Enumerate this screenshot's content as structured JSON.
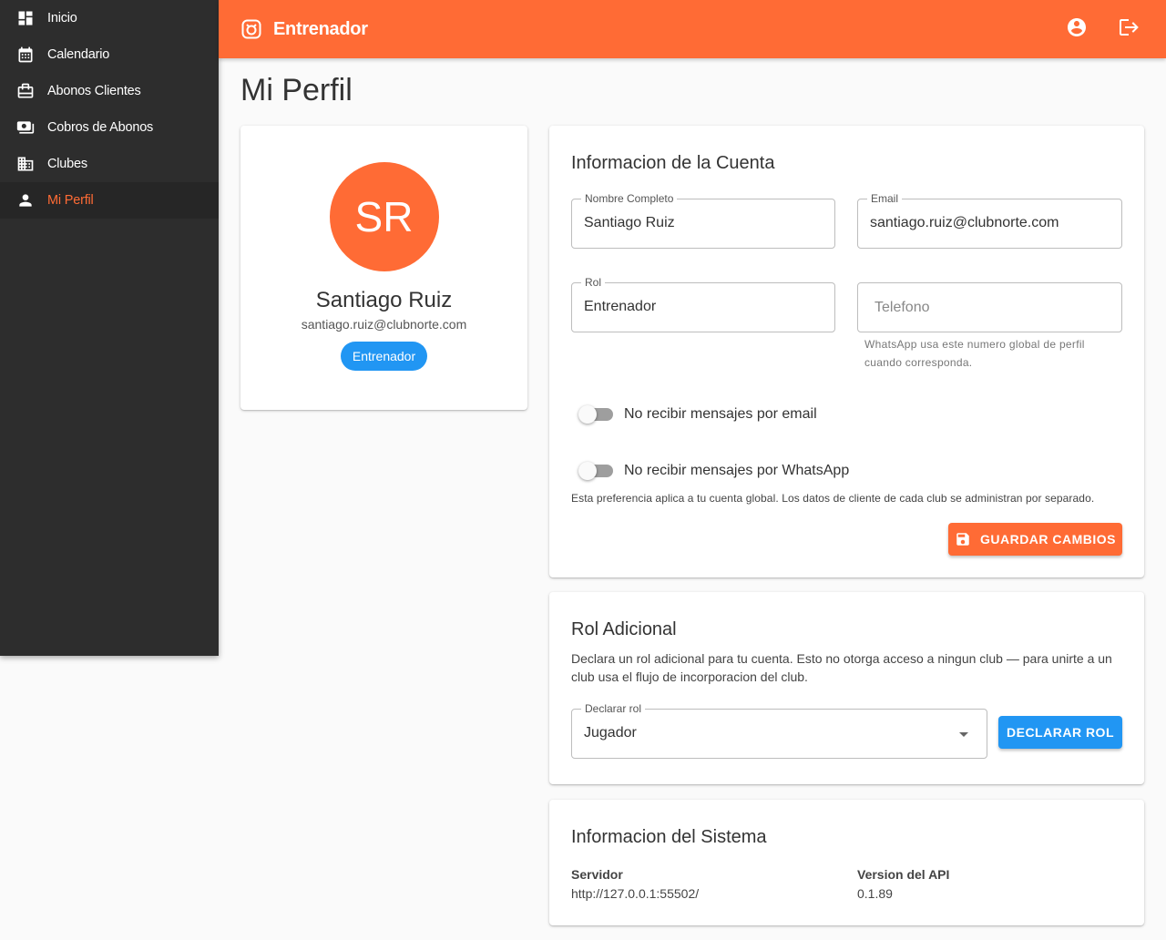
{
  "sidebar": {
    "items": [
      {
        "label": "Inicio",
        "icon": "dashboard-icon"
      },
      {
        "label": "Calendario",
        "icon": "calendar-icon"
      },
      {
        "label": "Abonos Clientes",
        "icon": "card-membership-icon"
      },
      {
        "label": "Cobros de Abonos",
        "icon": "payments-icon"
      },
      {
        "label": "Clubes",
        "icon": "building-icon"
      },
      {
        "label": "Mi Perfil",
        "icon": "person-icon",
        "active": true
      }
    ]
  },
  "header": {
    "title": "Entrenador",
    "brand_icon": "tennis-court-icon",
    "actions": [
      "account-circle-icon",
      "logout-icon"
    ]
  },
  "page": {
    "title": "Mi Perfil"
  },
  "profile": {
    "initials": "SR",
    "name": "Santiago Ruiz",
    "email": "santiago.ruiz@clubnorte.com",
    "role": "Entrenador"
  },
  "account": {
    "title": "Informacion de la Cuenta",
    "fields": {
      "full_name": {
        "label": "Nombre Completo",
        "value": "Santiago Ruiz"
      },
      "email": {
        "label": "Email",
        "value": "santiago.ruiz@clubnorte.com"
      },
      "role": {
        "label": "Rol",
        "value": "Entrenador"
      },
      "phone": {
        "placeholder": "Telefono",
        "helper_line1": "WhatsApp usa este numero global de perfil",
        "helper_line2": "cuando corresponda."
      }
    },
    "switches": [
      {
        "label": "No recibir mensajes por email",
        "on": false
      },
      {
        "label": "No recibir mensajes por WhatsApp",
        "on": false
      }
    ],
    "note": "Esta preferencia aplica a tu cuenta global. Los datos de cliente de cada club se administran por separado.",
    "save_label": "GUARDAR CAMBIOS"
  },
  "extra_role": {
    "title": "Rol Adicional",
    "description": "Declara un rol adicional para tu cuenta. Esto no otorga acceso a ningun club — para unirte a un club usa el flujo de incorporacion del club.",
    "select_label": "Declarar rol",
    "select_value": "Jugador",
    "button_label": "DECLARAR ROL"
  },
  "system": {
    "title": "Informacion del Sistema",
    "server_label": "Servidor",
    "server_value": "http://127.0.0.1:55502/",
    "api_label": "Version del API",
    "api_value": "0.1.89"
  },
  "colors": {
    "accent": "#ff6b35",
    "blue": "#2196f3",
    "sidebar": "#2d2d2d"
  }
}
